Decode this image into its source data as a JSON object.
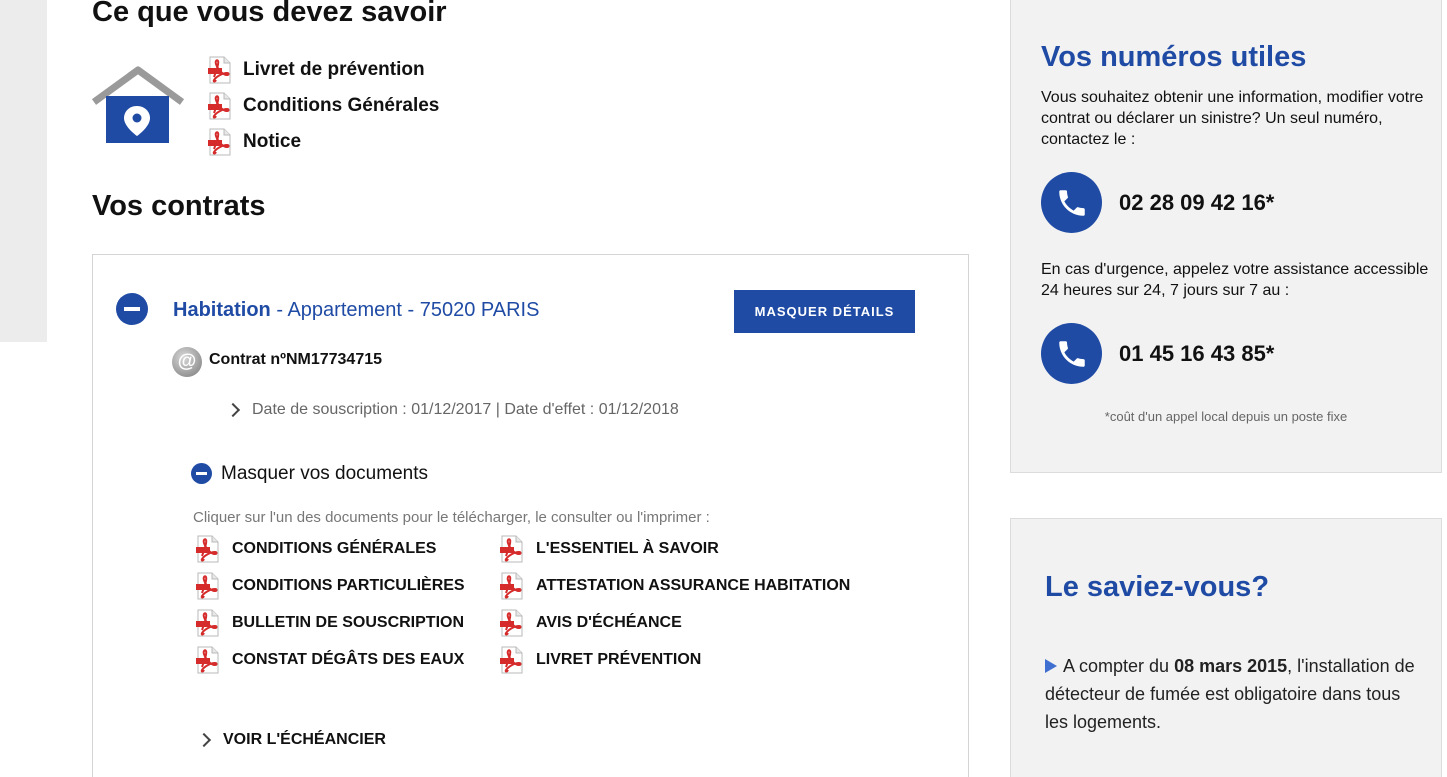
{
  "knowledge": {
    "title": "Ce que vous devez savoir",
    "links": [
      {
        "label": "Livret de prévention"
      },
      {
        "label": "Conditions Générales"
      },
      {
        "label": "Notice"
      }
    ]
  },
  "contracts": {
    "title": "Vos contrats",
    "item": {
      "type": "Habitation",
      "details": " - Appartement - 75020 PARIS",
      "toggle_button": "MASQUER DÉTAILS",
      "at_symbol": "@",
      "contract_number": "Contrat nºNM17734715",
      "dates": "Date de souscription : 01/12/2017 | Date d'effet : 01/12/2018",
      "documents_toggle": "Masquer vos documents",
      "documents_hint": "Cliquer sur l'un des documents pour le télécharger, le consulter ou l'imprimer :",
      "documents": [
        {
          "label": "CONDITIONS GÉNÉRALES"
        },
        {
          "label": "L'ESSENTIEL À SAVOIR"
        },
        {
          "label": "CONDITIONS PARTICULIÈRES"
        },
        {
          "label": "ATTESTATION ASSURANCE HABITATION"
        },
        {
          "label": "BULLETIN DE SOUSCRIPTION"
        },
        {
          "label": "AVIS D'ÉCHÉANCE"
        },
        {
          "label": "CONSTAT DÉGÂTS DES EAUX"
        },
        {
          "label": "LIVRET PRÉVENTION"
        }
      ],
      "schedule_link": "VOIR L'ÉCHÉANCIER"
    }
  },
  "useful_numbers": {
    "title": "Vos numéros utiles",
    "intro": "Vous souhaitez obtenir une information, modifier votre contrat ou déclarer un sinistre? Un seul numéro, contactez le :",
    "phone_main": "02 28 09 42 16*",
    "urgence": "En cas d'urgence, appelez votre assistance accessible 24 heures sur 24, 7 jours sur 7 au :",
    "phone_assistance": "01 45 16 43 85*",
    "footnote": "*coût d'un appel local depuis un poste fixe"
  },
  "did_you_know": {
    "title": "Le saviez-vous?",
    "text_before": "A compter du ",
    "date": "08 mars 2015",
    "text_after": ", l'installation de détecteur de fumée est obligatoire dans tous les logements."
  },
  "colors": {
    "brand_blue": "#1f4ba5",
    "panel_bg": "#f2f2f2",
    "pdf_red": "#d62b2b"
  },
  "icons": [
    "house-location-icon",
    "pdf-icon",
    "minus-circle-icon",
    "at-icon",
    "chevron-right-icon",
    "phone-icon",
    "triangle-bullet-icon"
  ]
}
